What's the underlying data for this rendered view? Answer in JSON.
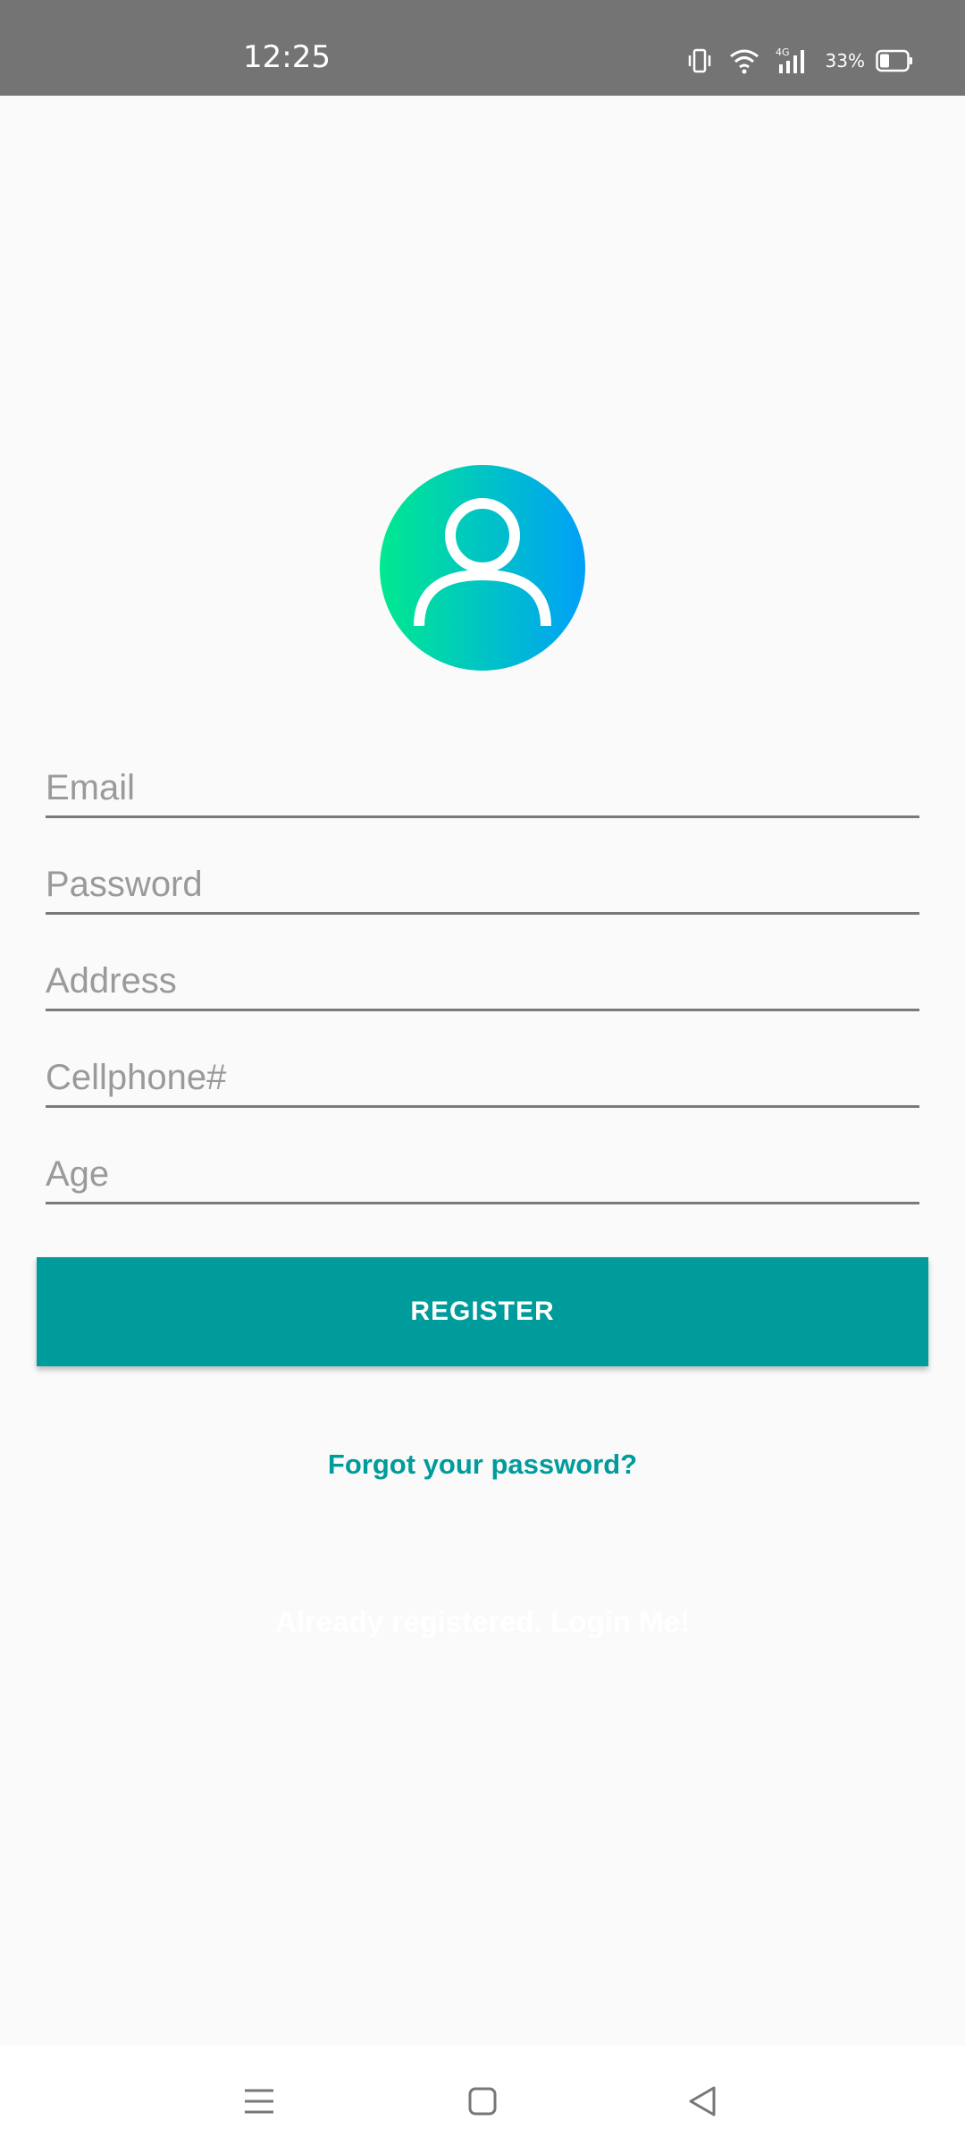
{
  "status_bar": {
    "time": "12:25",
    "battery_percent": "33%",
    "network_label": "4G",
    "icons": [
      "vibrate-icon",
      "wifi-icon",
      "signal-4g-icon",
      "battery-icon"
    ]
  },
  "form": {
    "email_placeholder": "Email",
    "password_placeholder": "Password",
    "address_placeholder": "Address",
    "cellphone_placeholder": "Cellphone#",
    "age_placeholder": "Age",
    "email_value": "",
    "password_value": "",
    "address_value": "",
    "cellphone_value": "",
    "age_value": ""
  },
  "actions": {
    "register_label": "REGISTER",
    "forgot_label": "Forgot your password?",
    "login_label": "Already registered. Login Me!"
  },
  "colors": {
    "accent": "#009c9c",
    "status_bar": "#747474",
    "avatar_gradient_start": "#00e98f",
    "avatar_gradient_end": "#00a0f8"
  },
  "nav": {
    "icons": [
      "menu-icon",
      "home-icon",
      "back-icon"
    ]
  }
}
